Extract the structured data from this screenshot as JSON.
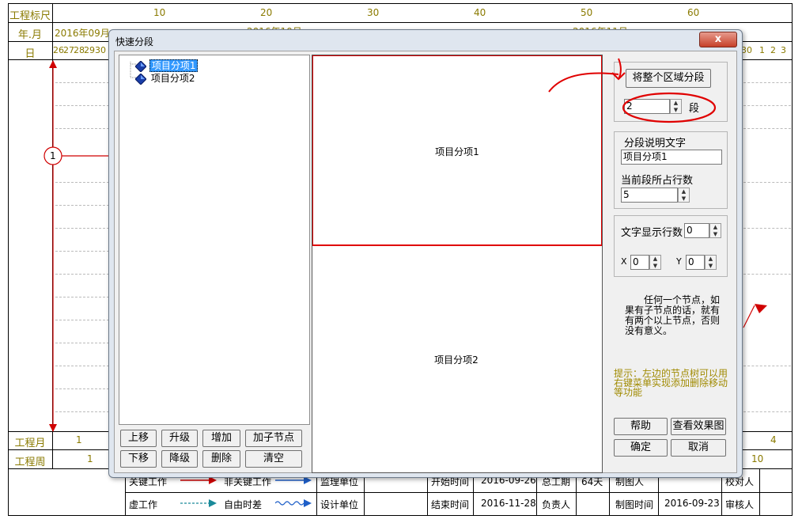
{
  "background": {
    "row_labels": {
      "scale": "工程标尺",
      "month": "年.月",
      "day": "日",
      "proj_month": "工程月",
      "proj_week": "工程周"
    },
    "scale_ticks": [
      "10",
      "20",
      "30",
      "40",
      "50",
      "60"
    ],
    "month_text": "2016年09月",
    "month_partial_1": "2016年10月",
    "month_partial_2": "2016年11月",
    "days_left": [
      "26",
      "27",
      "28",
      "29",
      "30"
    ],
    "days_right": [
      "30",
      "1",
      "2",
      "3"
    ],
    "node_label": "1",
    "proj_month_values": [
      "1",
      "4"
    ],
    "proj_week_values": [
      "1",
      "10"
    ],
    "legend": {
      "key_work": "关键工作",
      "nonkey_work": "非关键工作",
      "virtual_work": "虚工作",
      "free_float": "自由时差"
    },
    "info": {
      "supervisor": "监理单位",
      "designer": "设计单位",
      "start_label": "开始时间",
      "start_value": "2016-09-26",
      "end_label": "结束时间",
      "end_value": "2016-11-28",
      "duration_label": "总工期",
      "duration_value": "64天",
      "owner_label": "负责人",
      "drawer_label": "制图人",
      "draw_time_label": "制图时间",
      "draw_time_value": "2016-09-23",
      "checker_label": "校对人",
      "reviewer_label": "审核人"
    }
  },
  "dialog": {
    "title": "快速分段",
    "close_label": "x",
    "tree": [
      {
        "label": "项目分项1",
        "selected": true
      },
      {
        "label": "项目分项2",
        "selected": false
      }
    ],
    "tree_buttons": {
      "up": "上移",
      "upgrade": "升级",
      "add": "增加",
      "add_child": "加子节点",
      "down": "下移",
      "downgrade": "降级",
      "delete": "删除",
      "clear": "清空"
    },
    "segments": [
      "项目分项1",
      "项目分项2"
    ],
    "segment_whole_button": "将整个区域分段",
    "segment_count": "2",
    "segment_unit": "段",
    "desc_group_title": "分段说明文字",
    "desc_value": "项目分项1",
    "rows_label": "当前段所占行数",
    "rows_value": "5",
    "text_rows_label": "文字显示行数",
    "text_rows_value": "0",
    "x_label": "X",
    "x_value": "0",
    "y_label": "Y",
    "y_value": "0",
    "info_note": "任何一个节点，如果有子节点的话，就有有两个以上节点，否则没有意义。",
    "hint": "提示：左边的节点树可以用右键菜单实现添加删除移动等功能",
    "help_button": "帮助",
    "preview_button": "查看效果图",
    "ok_button": "确定",
    "cancel_button": "取消"
  }
}
